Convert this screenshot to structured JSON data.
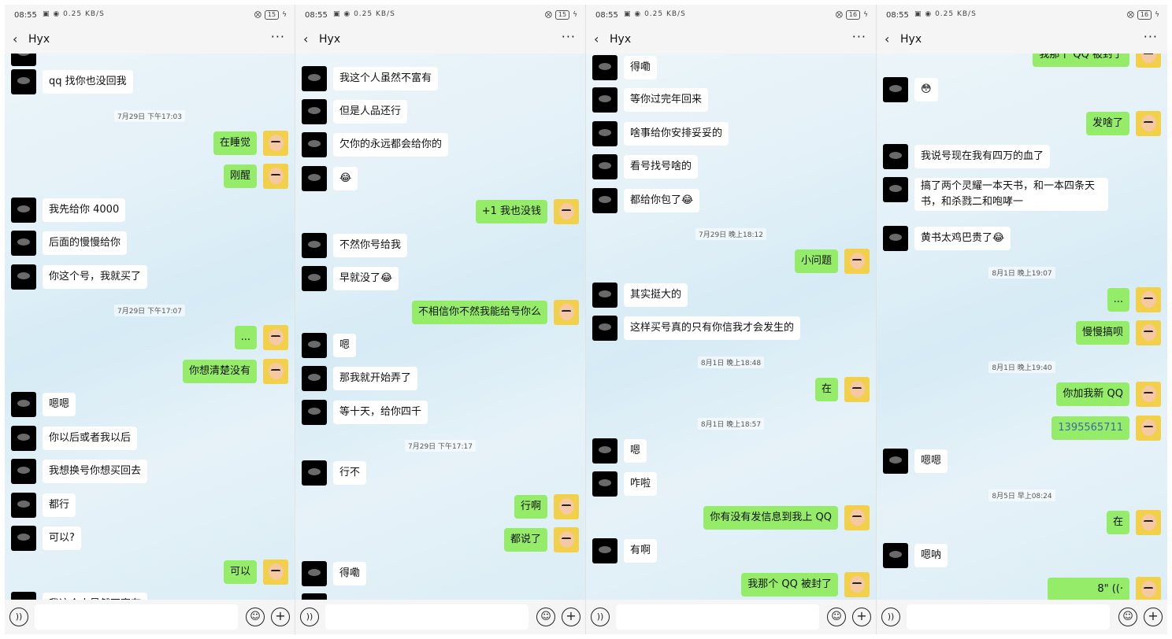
{
  "status_bar": {
    "time": "08:55",
    "net_speed": "0.25 KB/S"
  },
  "panels": [
    {
      "battery": "15",
      "contact": "Hyx",
      "messages": [
        {
          "kind": "in",
          "text": "qq 找你也没回我"
        },
        {
          "kind": "time",
          "text": "7月29日 下午17:03"
        },
        {
          "kind": "out",
          "text": "在睡觉"
        },
        {
          "kind": "out",
          "text": "刚醒"
        },
        {
          "kind": "in",
          "text": "我先给你 4000"
        },
        {
          "kind": "in",
          "text": "后面的慢慢给你"
        },
        {
          "kind": "in",
          "text": "你这个号，我就买了"
        },
        {
          "kind": "time",
          "text": "7月29日 下午17:07"
        },
        {
          "kind": "out",
          "text": "..."
        },
        {
          "kind": "out",
          "text": "你想清楚没有"
        },
        {
          "kind": "in",
          "text": "嗯嗯"
        },
        {
          "kind": "in",
          "text": "你以后或者我以后"
        },
        {
          "kind": "in",
          "text": "我想换号你想买回去"
        },
        {
          "kind": "in",
          "text": "都行"
        },
        {
          "kind": "in",
          "text": "可以?"
        },
        {
          "kind": "out",
          "text": "可以"
        },
        {
          "kind": "in",
          "text": "我这个人虽然不富有"
        }
      ]
    },
    {
      "battery": "15",
      "contact": "Hyx",
      "messages": [
        {
          "kind": "in",
          "text": "我这个人虽然不富有"
        },
        {
          "kind": "in",
          "text": "但是人品还行"
        },
        {
          "kind": "in",
          "text": "欠你的永远都会给你的"
        },
        {
          "kind": "in",
          "text": "😂"
        },
        {
          "kind": "out",
          "text": "+1 我也没钱"
        },
        {
          "kind": "in",
          "text": "不然你号给我"
        },
        {
          "kind": "in",
          "text": "早就没了😂"
        },
        {
          "kind": "out",
          "text": "不相信你不然我能给号你么"
        },
        {
          "kind": "in",
          "text": "嗯"
        },
        {
          "kind": "in",
          "text": "那我就开始弄了"
        },
        {
          "kind": "in",
          "text": "等十天，给你四千"
        },
        {
          "kind": "time",
          "text": "7月29日 下午17:17"
        },
        {
          "kind": "in",
          "text": "行不"
        },
        {
          "kind": "out",
          "text": "行啊"
        },
        {
          "kind": "out",
          "text": "都说了"
        },
        {
          "kind": "in",
          "text": "得嘞"
        }
      ]
    },
    {
      "battery": "16",
      "contact": "Hyx",
      "messages": [
        {
          "kind": "in",
          "text": "得嘞"
        },
        {
          "kind": "in",
          "text": "等你过完年回来"
        },
        {
          "kind": "in",
          "text": "啥事给你安排妥妥的"
        },
        {
          "kind": "in",
          "text": "看号找号啥的"
        },
        {
          "kind": "in",
          "text": "都给你包了😂"
        },
        {
          "kind": "time",
          "text": "7月29日 晚上18:12"
        },
        {
          "kind": "out",
          "text": "小问题"
        },
        {
          "kind": "in",
          "text": "其实挺大的"
        },
        {
          "kind": "in",
          "text": "这样买号真的只有你信我才会发生的"
        },
        {
          "kind": "time",
          "text": "8月1日 晚上18:48"
        },
        {
          "kind": "out",
          "text": "在"
        },
        {
          "kind": "time",
          "text": "8月1日 晚上18:57"
        },
        {
          "kind": "in",
          "text": "嗯"
        },
        {
          "kind": "in",
          "text": "咋啦"
        },
        {
          "kind": "out",
          "text": "你有没有发信息到我上 QQ"
        },
        {
          "kind": "in",
          "text": "有啊"
        },
        {
          "kind": "out",
          "text": "我那个 QQ 被封了"
        }
      ]
    },
    {
      "battery": "16",
      "contact": "Hyx",
      "messages": [
        {
          "kind": "out",
          "text": "我那个 QQ 被封了"
        },
        {
          "kind": "in",
          "text": "😳"
        },
        {
          "kind": "out",
          "text": "发啥了"
        },
        {
          "kind": "in",
          "text": "我说号现在我有四万的血了"
        },
        {
          "kind": "in",
          "text": "搞了两个灵耀一本天书，和一本四条天书，和杀戮二和咆哮一",
          "two_line": true
        },
        {
          "kind": "in",
          "text": "黄书太鸡巴贵了😂"
        },
        {
          "kind": "time",
          "text": "8月1日 晚上19:07"
        },
        {
          "kind": "out",
          "text": "..."
        },
        {
          "kind": "out",
          "text": "慢慢搞呗"
        },
        {
          "kind": "time",
          "text": "8月1日 晚上19:40"
        },
        {
          "kind": "out",
          "text": "你加我新 QQ"
        },
        {
          "kind": "out",
          "text": "1395565711",
          "link": true
        },
        {
          "kind": "in",
          "text": "嗯嗯"
        },
        {
          "kind": "time",
          "text": "8月5日 早上08:24"
        },
        {
          "kind": "out",
          "text": "在"
        },
        {
          "kind": "in",
          "text": "嗯呐"
        },
        {
          "kind": "out",
          "text": "8\" ((·",
          "voice": true
        }
      ]
    }
  ]
}
